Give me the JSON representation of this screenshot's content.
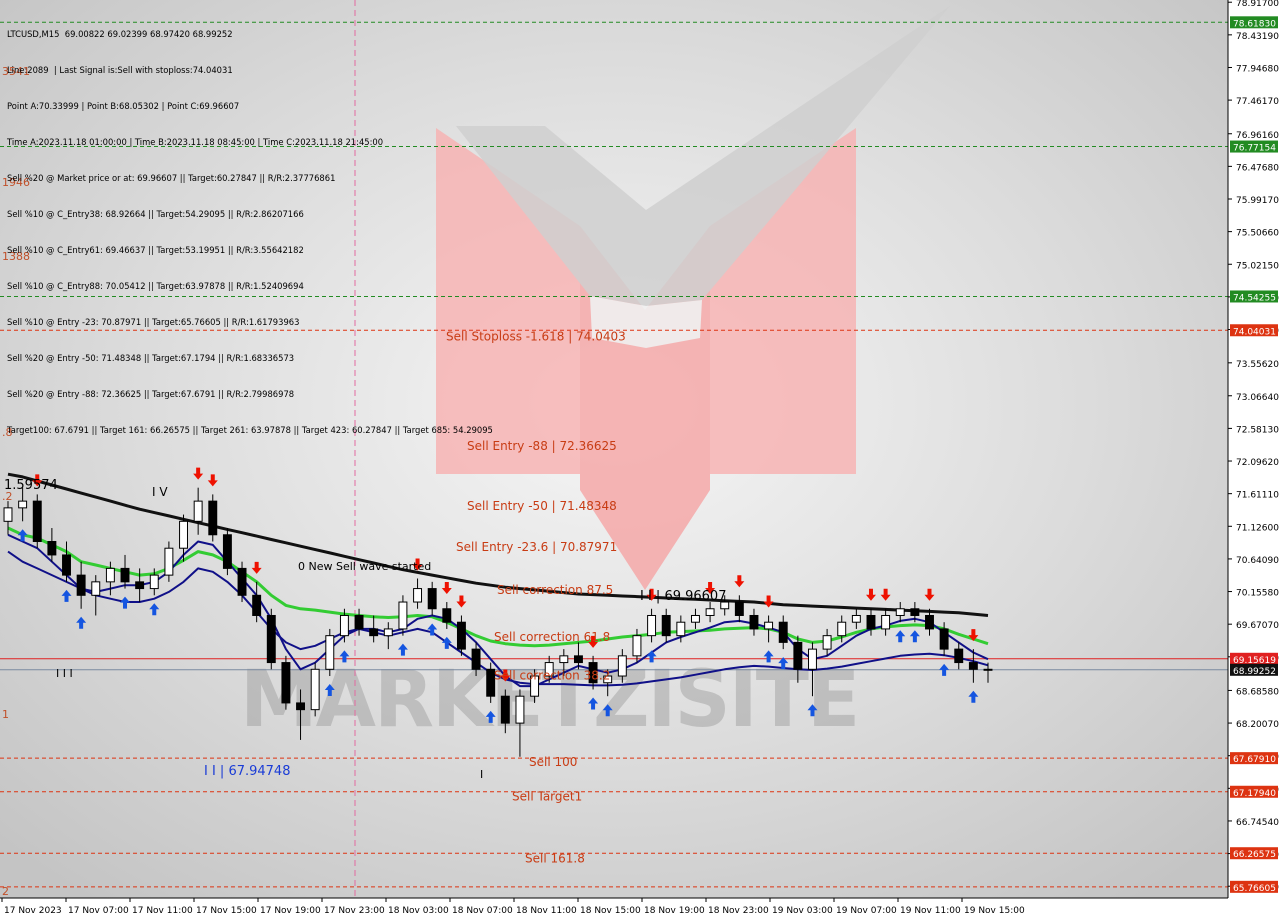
{
  "header": {
    "lines": [
      "LTCUSD,M15  69.00822 69.02399 68.97420 68.99252",
      "Line:2089  | Last Signal is:Sell with stoploss:74.04031",
      "Point A:70.33999 | Point B:68.05302 | Point C:69.96607",
      "Time A:2023.11.18 01:00:00 | Time B:2023.11.18 08:45:00 | Time C:2023.11.18 21:45:00",
      "Sell %20 @ Market price or at: 69.96607 || Target:60.27847 || R/R:2.37776861",
      "Sell %10 @ C_Entry38: 68.92664 || Target:54.29095 || R/R:2.86207166",
      "Sell %10 @ C_Entry61: 69.46637 || Target:53.19951 || R/R:3.55642182",
      "Sell %10 @ C_Entry88: 70.05412 || Target:63.97878 || R/R:1.52409694",
      "Sell %10 @ Entry -23: 70.87971 || Target:65.76605 || R/R:1.61793963",
      "Sell %20 @ Entry -50: 71.48348 || Target:67.1794 || R/R:1.68336573",
      "Sell %20 @ Entry -88: 72.36625 || Target:67.6791 || R/R:2.79986978",
      "Target100: 67.6791 || Target 161: 66.26575 || Target 261: 63.97878 || Target 423: 60.27847 || Target 685: 54.29095"
    ]
  },
  "colors": {
    "background": "#ffffff",
    "green_line": "#228b22",
    "red_line": "#dd3311",
    "sell_label": "#c83c14",
    "buy_arrow": "#1555e0",
    "sell_arrow": "#ee1100",
    "ma_black": "#111111",
    "ma_navy": "#101088",
    "ma_green": "#33cc33",
    "current_price_bg": "#111111"
  },
  "chart_data": {
    "type": "candlestick",
    "symbol": "LTCUSD",
    "timeframe": "M15",
    "ylim": [
      65.6,
      78.95
    ],
    "y_ticks": [
      "78.91700",
      "78.43190",
      "77.94680",
      "77.46170",
      "76.96160",
      "76.47680",
      "75.99170",
      "75.50660",
      "75.02150",
      "74.53640",
      "74.05130",
      "73.55620",
      "73.06640",
      "72.58130",
      "72.09620",
      "71.61110",
      "71.12600",
      "70.64090",
      "70.15580",
      "69.67070",
      "69.18560",
      "68.68580",
      "68.20070",
      "67.71560",
      "67.23050",
      "66.74540",
      "66.26030",
      "65.77520"
    ],
    "x_ticks": [
      "17 Nov 2023",
      "17 Nov 07:00",
      "17 Nov 11:00",
      "17 Nov 15:00",
      "17 Nov 19:00",
      "17 Nov 23:00",
      "18 Nov 03:00",
      "18 Nov 07:00",
      "18 Nov 11:00",
      "18 Nov 15:00",
      "18 Nov 19:00",
      "18 Nov 23:00",
      "19 Nov 03:00",
      "19 Nov 07:00",
      "19 Nov 11:00",
      "19 Nov 15:00"
    ],
    "levels": [
      {
        "price": 78.6183,
        "tag": "78.61830",
        "kind": "green"
      },
      {
        "price": 76.77154,
        "tag": "76.77154",
        "kind": "green"
      },
      {
        "price": 74.54255,
        "tag": "74.54255",
        "kind": "green"
      },
      {
        "price": 74.04031,
        "tag": "74.04031",
        "kind": "red"
      },
      {
        "price": 67.6791,
        "tag": "67.67910",
        "kind": "red"
      },
      {
        "price": 67.1794,
        "tag": "67.17940",
        "kind": "red"
      },
      {
        "price": 66.26575,
        "tag": "66.26575",
        "kind": "red"
      },
      {
        "price": 65.76605,
        "tag": "65.76605",
        "kind": "red"
      }
    ],
    "signal_line": {
      "price": 69.15619,
      "tag": "69.15619"
    },
    "current_price": {
      "price": 68.99252,
      "tag": "68.99252"
    },
    "level_labels": [
      {
        "text": "Sell Stoploss -1.618 | 74.0403",
        "price": 73.89
      },
      {
        "text": "Sell Entry -88 | 72.36625",
        "price": 72.26
      },
      {
        "text": "Sell Entry -50 | 71.48348",
        "price": 71.37
      },
      {
        "text": "Sell Entry -23.6 | 70.87971",
        "price": 70.76
      },
      {
        "text": "Sell correction 87.5",
        "price": 70.12
      },
      {
        "text": "Sell correction 61.8",
        "price": 69.42
      },
      {
        "text": "Sell correction 38.2",
        "price": 68.85
      },
      {
        "text": "Sell 100",
        "price": 67.56
      },
      {
        "text": "Sell Target1",
        "price": 67.05
      },
      {
        "text": "Sell 161.8",
        "price": 66.13
      }
    ],
    "left_fib_labels": [
      "3541",
      "1946",
      "1388",
      ".8",
      "1.59574",
      ".2",
      "1",
      "2"
    ],
    "point_labels": {
      "point_a": "1.59574",
      "point_a_mark": "I V",
      "point_b": "I I | 67.94748",
      "point_c": "I I | 69.96607",
      "pivot_mark": "I I I",
      "tick_mark": "I",
      "wave_note": "0 New Sell wave started"
    },
    "watermark": "MARKETZISITE",
    "series": [
      {
        "name": "ohlc",
        "values": [
          [
            71.2,
            71.5,
            71.0,
            71.4
          ],
          [
            71.4,
            71.7,
            71.2,
            71.5
          ],
          [
            71.5,
            71.6,
            70.8,
            70.9
          ],
          [
            70.9,
            71.1,
            70.6,
            70.7
          ],
          [
            70.7,
            70.9,
            70.3,
            70.4
          ],
          [
            70.4,
            70.6,
            69.9,
            70.1
          ],
          [
            70.1,
            70.4,
            69.8,
            70.3
          ],
          [
            70.3,
            70.6,
            70.1,
            70.5
          ],
          [
            70.5,
            70.7,
            70.2,
            70.3
          ],
          [
            70.3,
            70.5,
            70.0,
            70.2
          ],
          [
            70.2,
            70.5,
            70.1,
            70.4
          ],
          [
            70.4,
            70.9,
            70.3,
            70.8
          ],
          [
            70.8,
            71.3,
            70.6,
            71.2
          ],
          [
            71.2,
            71.7,
            71.0,
            71.5
          ],
          [
            71.5,
            71.6,
            70.9,
            71.0
          ],
          [
            71.0,
            71.1,
            70.4,
            70.5
          ],
          [
            70.5,
            70.6,
            70.0,
            70.1
          ],
          [
            70.1,
            70.3,
            69.7,
            69.8
          ],
          [
            69.8,
            69.9,
            69.0,
            69.1
          ],
          [
            69.1,
            69.2,
            68.4,
            68.5
          ],
          [
            68.5,
            68.7,
            67.95,
            68.4
          ],
          [
            68.4,
            69.1,
            68.3,
            69.0
          ],
          [
            69.0,
            69.6,
            68.9,
            69.5
          ],
          [
            69.5,
            69.9,
            69.4,
            69.8
          ],
          [
            69.8,
            69.9,
            69.5,
            69.6
          ],
          [
            69.6,
            69.8,
            69.4,
            69.5
          ],
          [
            69.5,
            69.7,
            69.3,
            69.6
          ],
          [
            69.6,
            70.1,
            69.5,
            70.0
          ],
          [
            70.0,
            70.35,
            69.9,
            70.2
          ],
          [
            70.2,
            70.3,
            69.8,
            69.9
          ],
          [
            69.9,
            70.0,
            69.6,
            69.7
          ],
          [
            69.7,
            69.8,
            69.2,
            69.3
          ],
          [
            69.3,
            69.4,
            68.9,
            69.0
          ],
          [
            69.0,
            69.1,
            68.5,
            68.6
          ],
          [
            68.6,
            68.7,
            68.05,
            68.2
          ],
          [
            68.2,
            68.7,
            67.7,
            68.6
          ],
          [
            68.6,
            69.0,
            68.5,
            68.9
          ],
          [
            68.9,
            69.2,
            68.8,
            69.1
          ],
          [
            69.1,
            69.3,
            68.9,
            69.2
          ],
          [
            69.2,
            69.4,
            69.0,
            69.1
          ],
          [
            69.1,
            69.2,
            68.7,
            68.8
          ],
          [
            68.8,
            69.0,
            68.6,
            68.9
          ],
          [
            68.9,
            69.3,
            68.8,
            69.2
          ],
          [
            69.2,
            69.6,
            69.1,
            69.5
          ],
          [
            69.5,
            69.9,
            69.4,
            69.8
          ],
          [
            69.8,
            69.9,
            69.4,
            69.5
          ],
          [
            69.5,
            69.8,
            69.4,
            69.7
          ],
          [
            69.7,
            69.9,
            69.6,
            69.8
          ],
          [
            69.8,
            70.0,
            69.7,
            69.9
          ],
          [
            69.9,
            70.1,
            69.8,
            70.0
          ],
          [
            70.0,
            70.1,
            69.7,
            69.8
          ],
          [
            69.8,
            69.9,
            69.5,
            69.6
          ],
          [
            69.6,
            69.8,
            69.4,
            69.7
          ],
          [
            69.7,
            69.8,
            69.3,
            69.4
          ],
          [
            69.4,
            69.5,
            68.8,
            69.0
          ],
          [
            69.0,
            69.4,
            68.6,
            69.3
          ],
          [
            69.3,
            69.6,
            69.2,
            69.5
          ],
          [
            69.5,
            69.8,
            69.4,
            69.7
          ],
          [
            69.7,
            69.9,
            69.6,
            69.8
          ],
          [
            69.8,
            69.9,
            69.5,
            69.6
          ],
          [
            69.6,
            69.9,
            69.5,
            69.8
          ],
          [
            69.8,
            70.0,
            69.7,
            69.9
          ],
          [
            69.9,
            70.0,
            69.7,
            69.8
          ],
          [
            69.8,
            69.9,
            69.5,
            69.6
          ],
          [
            69.6,
            69.7,
            69.2,
            69.3
          ],
          [
            69.3,
            69.4,
            69.0,
            69.1
          ],
          [
            69.1,
            69.3,
            68.8,
            69.0
          ],
          [
            69.0,
            69.1,
            68.8,
            69.0
          ]
        ]
      },
      {
        "name": "ma_black",
        "values": [
          71.9,
          71.86,
          71.8,
          71.74,
          71.68,
          71.62,
          71.56,
          71.5,
          71.44,
          71.38,
          71.33,
          71.28,
          71.23,
          71.18,
          71.13,
          71.08,
          71.03,
          70.98,
          70.93,
          70.88,
          70.83,
          70.78,
          70.73,
          70.68,
          70.63,
          70.58,
          70.53,
          70.48,
          70.44,
          70.4,
          70.36,
          70.32,
          70.28,
          70.25,
          70.22,
          70.2,
          70.18,
          70.16,
          70.14,
          70.12,
          70.11,
          70.1,
          70.09,
          70.08,
          70.07,
          70.06,
          70.05,
          70.04,
          70.03,
          70.02,
          70.01,
          70.0,
          69.98,
          69.96,
          69.95,
          69.94,
          69.93,
          69.92,
          69.91,
          69.9,
          69.89,
          69.88,
          69.87,
          69.86,
          69.85,
          69.84,
          69.82,
          69.8
        ]
      },
      {
        "name": "ma_green",
        "values": [
          71.1,
          71.0,
          70.95,
          70.85,
          70.75,
          70.6,
          70.55,
          70.5,
          70.45,
          70.4,
          70.42,
          70.5,
          70.62,
          70.75,
          70.7,
          70.6,
          70.45,
          70.3,
          70.1,
          69.95,
          69.9,
          69.88,
          69.85,
          69.82,
          69.8,
          69.78,
          69.77,
          69.78,
          69.8,
          69.78,
          69.7,
          69.6,
          69.5,
          69.42,
          69.38,
          69.36,
          69.35,
          69.36,
          69.38,
          69.4,
          69.42,
          69.45,
          69.48,
          69.5,
          69.52,
          69.55,
          69.56,
          69.57,
          69.58,
          69.6,
          69.61,
          69.62,
          69.6,
          69.55,
          69.45,
          69.4,
          69.42,
          69.48,
          69.55,
          69.6,
          69.63,
          69.65,
          69.66,
          69.65,
          69.6,
          69.52,
          69.45,
          69.38
        ]
      },
      {
        "name": "ma_navy",
        "values": [
          70.75,
          70.6,
          70.5,
          70.4,
          70.3,
          70.2,
          70.1,
          70.05,
          70.0,
          70.0,
          70.05,
          70.15,
          70.3,
          70.5,
          70.45,
          70.3,
          70.1,
          69.85,
          69.6,
          69.4,
          69.3,
          69.35,
          69.45,
          69.55,
          69.6,
          69.55,
          69.5,
          69.55,
          69.6,
          69.55,
          69.4,
          69.25,
          69.1,
          68.95,
          68.85,
          68.8,
          68.78,
          68.78,
          68.78,
          68.77,
          68.76,
          68.76,
          68.77,
          68.79,
          68.82,
          68.85,
          68.88,
          68.92,
          68.96,
          69.0,
          69.03,
          69.05,
          69.04,
          69.02,
          69.0,
          68.99,
          69.01,
          69.04,
          69.08,
          69.12,
          69.16,
          69.2,
          69.22,
          69.23,
          69.21,
          69.17,
          69.12,
          69.06
        ]
      },
      {
        "name": "ma_navy_fast",
        "values": [
          71.0,
          70.9,
          70.8,
          70.6,
          70.4,
          70.2,
          70.15,
          70.2,
          70.25,
          70.25,
          70.3,
          70.45,
          70.7,
          70.9,
          70.85,
          70.6,
          70.35,
          70.1,
          69.75,
          69.3,
          69.0,
          69.1,
          69.3,
          69.5,
          69.6,
          69.6,
          69.55,
          69.6,
          69.75,
          69.8,
          69.75,
          69.6,
          69.4,
          69.15,
          68.9,
          68.75,
          68.75,
          68.85,
          68.95,
          69.05,
          69.0,
          68.95,
          69.0,
          69.1,
          69.25,
          69.4,
          69.48,
          69.55,
          69.62,
          69.7,
          69.72,
          69.68,
          69.62,
          69.55,
          69.3,
          69.15,
          69.2,
          69.35,
          69.5,
          69.6,
          69.65,
          69.72,
          69.75,
          69.7,
          69.55,
          69.4,
          69.25,
          69.15
        ]
      }
    ],
    "buy_arrows": [
      1,
      4,
      5,
      8,
      10,
      22,
      23,
      27,
      29,
      30,
      33,
      40,
      41,
      44,
      52,
      53,
      55,
      61,
      62,
      64,
      66
    ],
    "sell_arrows": [
      2,
      13,
      14,
      17,
      28,
      30,
      31,
      34,
      40,
      44,
      48,
      50,
      52,
      59,
      60,
      63,
      66
    ]
  }
}
